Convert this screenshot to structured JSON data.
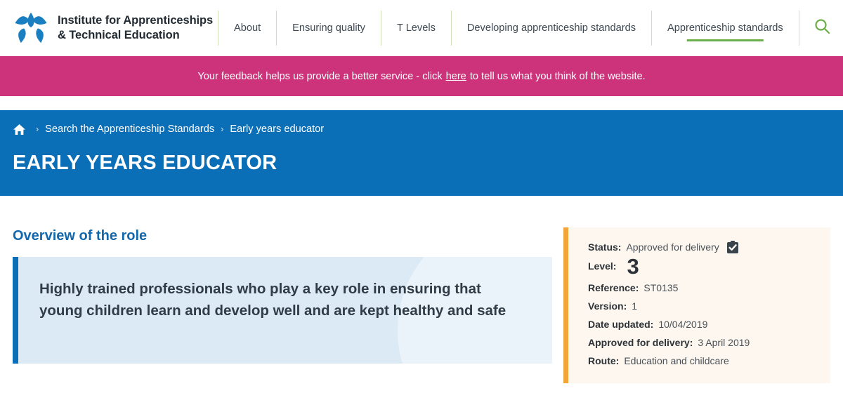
{
  "header": {
    "brand": {
      "logo_icon": "flower-star-logo",
      "line1": "Institute for Apprenticeships",
      "line2": "& Technical Education"
    },
    "nav_items": [
      {
        "label": "About",
        "active": false
      },
      {
        "label": "Ensuring quality",
        "active": false
      },
      {
        "label": "T Levels",
        "active": false
      },
      {
        "label": "Developing apprenticeship standards",
        "active": false
      },
      {
        "label": "Apprenticeship standards",
        "active": true
      }
    ],
    "search_icon": "search-icon"
  },
  "feedback": {
    "text_before": "Your feedback helps us provide a better service - click",
    "link_label": "here",
    "text_after": "to tell us what you think of the website."
  },
  "hero": {
    "home_icon": "home-icon",
    "separator": "›",
    "breadcrumb": [
      {
        "label": "Search the Apprenticeship Standards"
      },
      {
        "label": "Early years educator"
      }
    ],
    "title": "EARLY YEARS EDUCATOR",
    "rss_icon": "rss-feed-icon"
  },
  "overview": {
    "section_title": "Overview of the role",
    "quote": "Highly trained professionals who play a key role in ensuring that young children learn and develop well and are kept healthy and safe"
  },
  "info_panel": {
    "status_label": "Status:",
    "status_value": "Approved for delivery",
    "status_icon": "clipboard-check-icon",
    "level_label": "Level:",
    "level_value": "3",
    "reference_label": "Reference:",
    "reference_value": "ST0135",
    "version_label": "Version:",
    "version_value": "1",
    "date_updated_label": "Date updated:",
    "date_updated_value": "10/04/2019",
    "approved_label": "Approved for delivery:",
    "approved_value": "3 April 2019",
    "route_label": "Route:",
    "route_value": "Education and childcare"
  },
  "colors": {
    "brand_blue": "#0b6fb8",
    "accent_pink": "#cc337a",
    "accent_green": "#6cae47",
    "accent_orange": "#f0a43a",
    "quote_bg": "#dceaf6",
    "panel_bg": "#fdf7ef"
  }
}
